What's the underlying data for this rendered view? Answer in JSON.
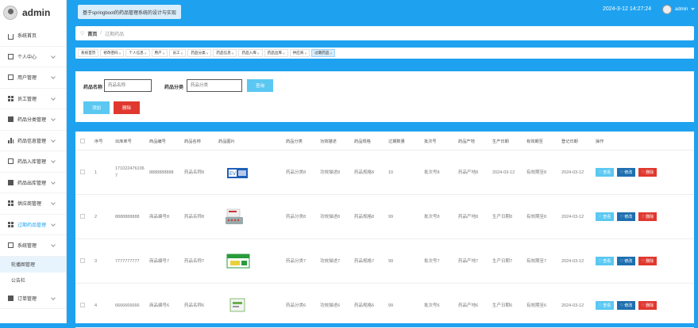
{
  "app": {
    "brand": "admin",
    "system_title": "基于springboot的药品管理系统的设计与实现",
    "datetime": "2024-3-12 14:27:24",
    "user": "admin"
  },
  "sidebar": {
    "items": [
      {
        "label": "系统首页",
        "icon": "home-icon",
        "arrow": false
      },
      {
        "label": "个人中心",
        "icon": "user-card-icon",
        "arrow": true
      },
      {
        "label": "用户管理",
        "icon": "list-icon",
        "arrow": true
      },
      {
        "label": "员工管理",
        "icon": "grid-icon",
        "arrow": true
      },
      {
        "label": "药品分类管理",
        "icon": "category-icon",
        "arrow": true
      },
      {
        "label": "药品信息管理",
        "icon": "chart-icon",
        "arrow": true
      },
      {
        "label": "药品入库管理",
        "icon": "inbound-icon",
        "arrow": true
      },
      {
        "label": "药品出库管理",
        "icon": "outbound-icon",
        "arrow": true
      },
      {
        "label": "供应商管理",
        "icon": "grid-icon",
        "arrow": true
      },
      {
        "label": "过期药品管理",
        "icon": "grid-icon",
        "arrow": true,
        "active": true
      },
      {
        "label": "系统管理",
        "icon": "settings-icon",
        "arrow": true,
        "expanded": true
      }
    ],
    "sub_items": [
      "轮播图管理",
      "公告栏"
    ],
    "last_item": {
      "label": "订单管理",
      "icon": "shield-icon"
    }
  },
  "breadcrumb": {
    "home": "首页",
    "current": "过期药品"
  },
  "tags": [
    {
      "label": "系统首页",
      "close": false
    },
    {
      "label": "修改密码",
      "close": true
    },
    {
      "label": "个人信息",
      "close": true
    },
    {
      "label": "用户",
      "close": true
    },
    {
      "label": "员工",
      "close": true
    },
    {
      "label": "药品分类",
      "close": true
    },
    {
      "label": "药品信息",
      "close": true
    },
    {
      "label": "药品入库",
      "close": true
    },
    {
      "label": "药品出库",
      "close": true
    },
    {
      "label": "供应商",
      "close": true
    },
    {
      "label": "过期药品",
      "close": true,
      "active": true
    }
  ],
  "search": {
    "name_label": "药品名称",
    "name_placeholder": "药品名称",
    "category_label": "药品分类",
    "category_placeholder": "药品分类",
    "search_btn": "查询",
    "add_btn": "添加",
    "delete_btn": "删除"
  },
  "table": {
    "columns": [
      "序号",
      "出库单号",
      "商品编号",
      "药品名称",
      "药品图片",
      "药品分类",
      "功效描述",
      "药品规格",
      "过期数量",
      "批次号",
      "药品产地",
      "生产日期",
      "有效期至",
      "登记日期",
      "操作"
    ],
    "actions": {
      "view": "查看",
      "edit": "修改",
      "delete": "删除"
    },
    "rows": [
      {
        "index": "1",
        "order_no": "1710224761067",
        "product_no": "8888888888",
        "name": "药品名称8",
        "category": "药品分类8",
        "effect": "功效描述8",
        "spec": "药品规格8",
        "qty": "10",
        "batch": "批次号8",
        "origin": "药品产地8",
        "prod_date": "2024-03-12",
        "expiry": "有效期至8",
        "reg_date": "2024-03-12"
      },
      {
        "index": "2",
        "order_no": "8888888888",
        "product_no": "商品编号8",
        "name": "药品名称8",
        "category": "药品分类8",
        "effect": "功效描述8",
        "spec": "药品规格8",
        "qty": "99",
        "batch": "批次号8",
        "origin": "药品产地8",
        "prod_date": "生产日期8",
        "expiry": "有效期至8",
        "reg_date": "2024-03-12"
      },
      {
        "index": "3",
        "order_no": "7777777777",
        "product_no": "商品编号7",
        "name": "药品名称7",
        "category": "药品分类7",
        "effect": "功效描述7",
        "spec": "药品规格7",
        "qty": "99",
        "batch": "批次号7",
        "origin": "药品产地7",
        "prod_date": "生产日期7",
        "expiry": "有效期至7",
        "reg_date": "2024-03-12"
      },
      {
        "index": "4",
        "order_no": "6666666666",
        "product_no": "商品编号6",
        "name": "药品名称6",
        "category": "药品分类6",
        "effect": "功效描述6",
        "spec": "药品规格6",
        "qty": "99",
        "batch": "批次号6",
        "origin": "药品产地6",
        "prod_date": "生产日期6",
        "expiry": "有效期至6",
        "reg_date": "2024-03-12"
      }
    ]
  },
  "colors": {
    "accent": "#1ea2ef",
    "search_btn": "#5bc8f2",
    "danger": "#e0382f",
    "edit": "#1e6fb0"
  }
}
